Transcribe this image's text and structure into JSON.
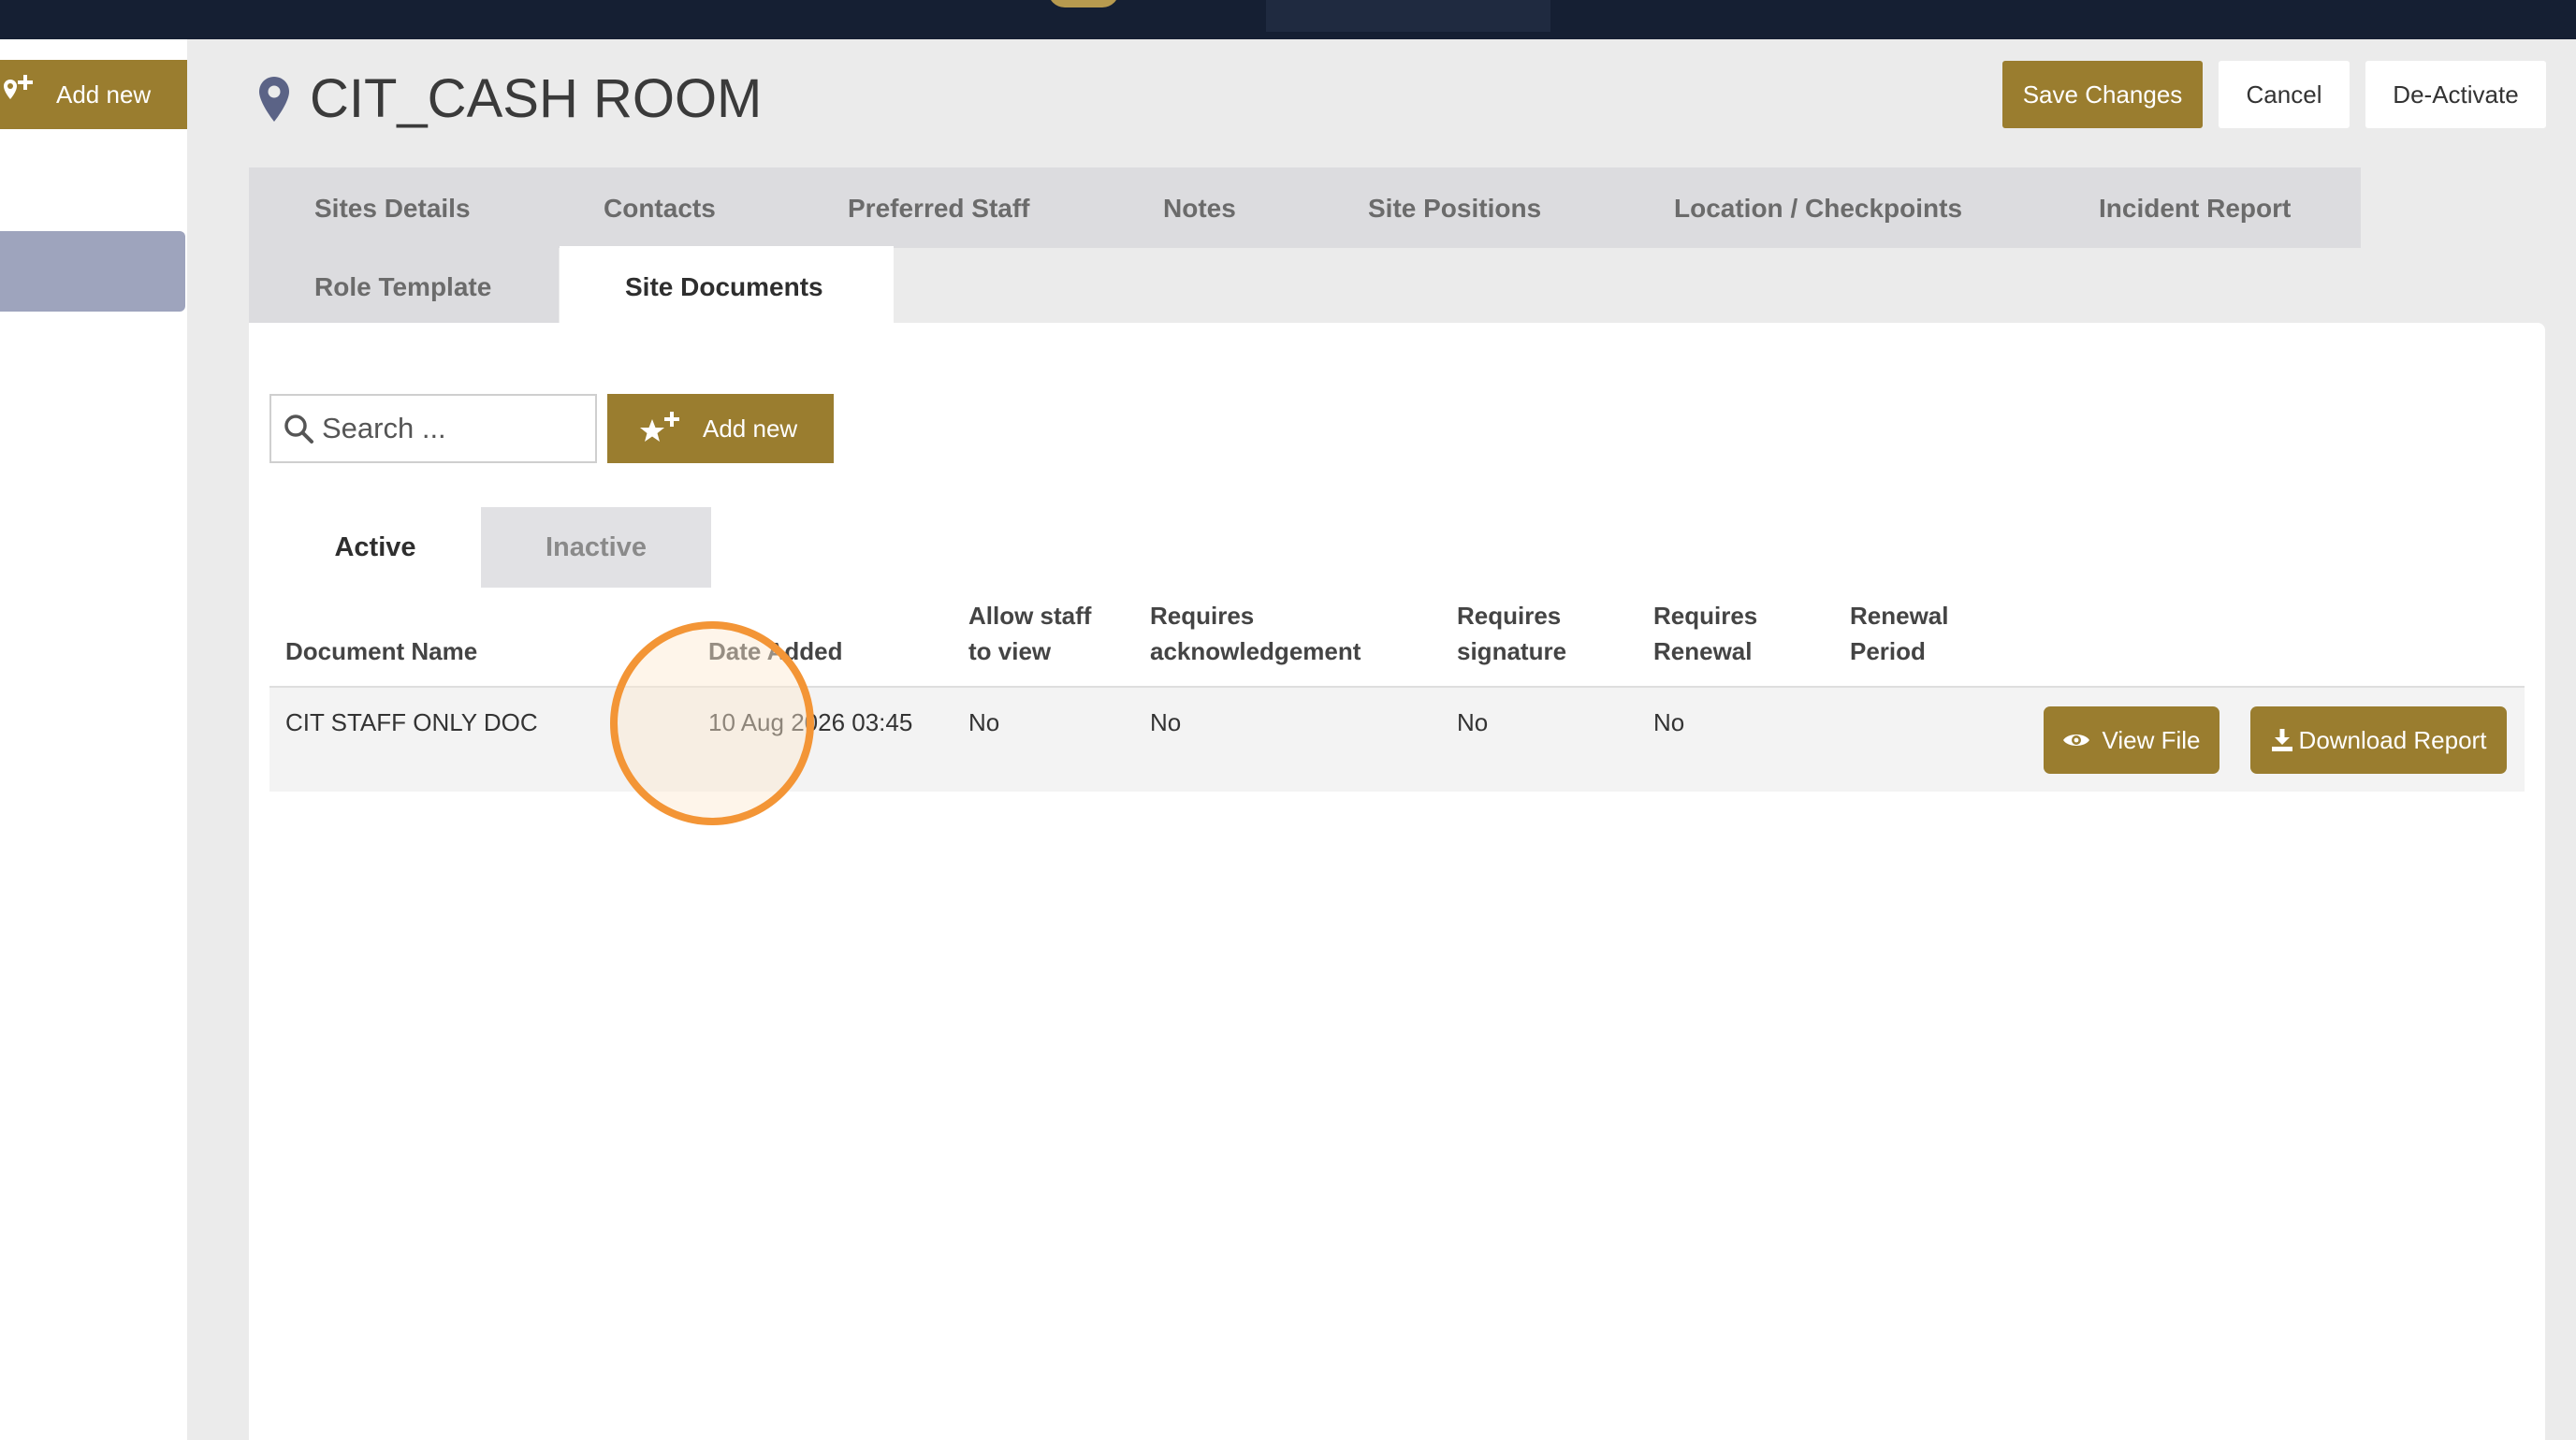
{
  "header": {
    "title": "CIT_CASH ROOM",
    "save_label": "Save Changes",
    "cancel_label": "Cancel",
    "deactivate_label": "De-Activate"
  },
  "sidebar": {
    "add_new_label": "Add new"
  },
  "tabs": [
    {
      "label": "Sites Details",
      "active": false
    },
    {
      "label": "Contacts",
      "active": false
    },
    {
      "label": "Preferred Staff",
      "active": false
    },
    {
      "label": "Notes",
      "active": false
    },
    {
      "label": "Site Positions",
      "active": false
    },
    {
      "label": "Location / Checkpoints",
      "active": false
    },
    {
      "label": "Incident Report",
      "active": false
    },
    {
      "label": "Role Template",
      "active": false
    },
    {
      "label": "Site Documents",
      "active": true
    }
  ],
  "documents": {
    "search_placeholder": "Search ...",
    "add_new_label": "Add new",
    "subtabs": [
      {
        "label": "Active",
        "active": true
      },
      {
        "label": "Inactive",
        "active": false
      }
    ],
    "columns": {
      "document_name": "Document Name",
      "date_added": "Date Added",
      "allow_staff_l1": "Allow staff",
      "allow_staff_l2": "to view",
      "requires_ack_l1": "Requires",
      "requires_ack_l2": "acknowledgement",
      "requires_sig_l1": "Requires",
      "requires_sig_l2": "signature",
      "requires_ren_l1": "Requires",
      "requires_ren_l2": "Renewal",
      "renewal_period_l1": "Renewal",
      "renewal_period_l2": "Period"
    },
    "rows": [
      {
        "document_name": "CIT STAFF ONLY DOC",
        "date_added": "10 Aug 2026 03:45",
        "allow_staff_to_view": "No",
        "requires_acknowledgement": "No",
        "requires_signature": "No",
        "requires_renewal": "No",
        "renewal_period": "",
        "view_label": "View File",
        "download_label": "Download Report"
      }
    ]
  },
  "colors": {
    "accent": "#9a7d2f",
    "navbar": "#151f33",
    "sidebar_selected": "#9ea4bd",
    "cursor_highlight": "#f39536"
  }
}
